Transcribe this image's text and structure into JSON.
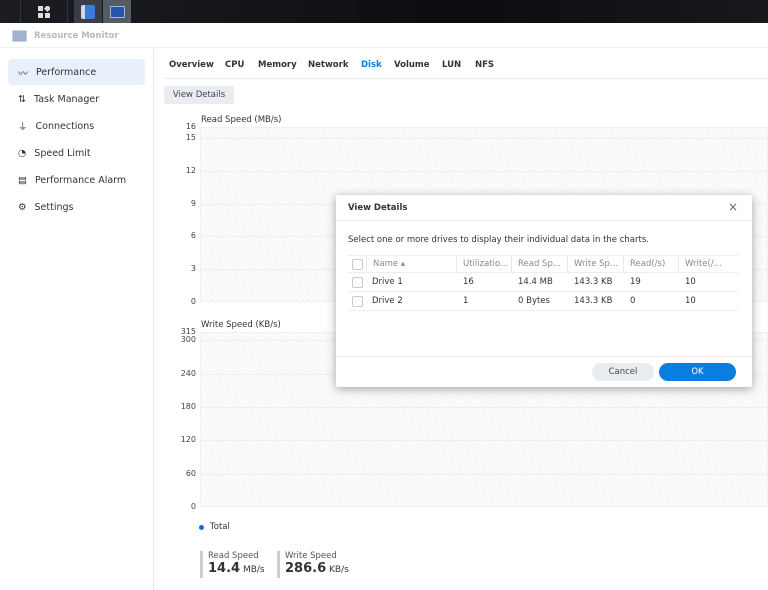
{
  "app": {
    "title": "Resource Monitor"
  },
  "sidebar": {
    "items": [
      {
        "label": "Performance",
        "icon": "performance-icon",
        "active": true
      },
      {
        "label": "Task Manager",
        "icon": "task-manager-icon"
      },
      {
        "label": "Connections",
        "icon": "plug-icon"
      },
      {
        "label": "Speed Limit",
        "icon": "gauge-icon"
      },
      {
        "label": "Performance Alarm",
        "icon": "alarm-icon"
      },
      {
        "label": "Settings",
        "icon": "gear-icon"
      }
    ]
  },
  "tabs": [
    {
      "label": "Overview"
    },
    {
      "label": "CPU"
    },
    {
      "label": "Memory"
    },
    {
      "label": "Network"
    },
    {
      "label": "Disk",
      "active": true
    },
    {
      "label": "Volume"
    },
    {
      "label": "LUN"
    },
    {
      "label": "NFS"
    }
  ],
  "toolbar": {
    "view_details": "View Details"
  },
  "chart_data": [
    {
      "type": "line",
      "title": "Read Speed (MB/s)",
      "ylim": [
        0,
        16
      ],
      "yticks": [
        "16",
        "15",
        "12",
        "9",
        "6",
        "3",
        "0"
      ],
      "series": [
        {
          "name": "Total",
          "values": []
        }
      ]
    },
    {
      "type": "line",
      "title": "Write Speed (KB/s)",
      "ylim": [
        0,
        315
      ],
      "yticks": [
        "315",
        "300",
        "240",
        "180",
        "120",
        "60",
        "0"
      ],
      "series": [
        {
          "name": "Total",
          "values": []
        }
      ]
    }
  ],
  "legend": {
    "label": "Total",
    "color": "#0a6fe0"
  },
  "stats": {
    "read_label": "Read Speed",
    "read_value": "14.4",
    "read_unit": "MB/s",
    "write_label": "Write Speed",
    "write_value": "286.6",
    "write_unit": "KB/s"
  },
  "dialog": {
    "title": "View Details",
    "description": "Select one or more drives to display their individual data in the charts.",
    "columns": [
      "Name ▴",
      "Utilizatio...",
      "Read Sp...",
      "Write Sp...",
      "Read(/s)",
      "Write(/..."
    ],
    "rows": [
      [
        "Drive 1",
        "16",
        "14.4 MB",
        "143.3 KB",
        "19",
        "10"
      ],
      [
        "Drive 2",
        "1",
        "0 Bytes",
        "143.3 KB",
        "0",
        "10"
      ]
    ],
    "cancel": "Cancel",
    "ok": "OK"
  },
  "colors": {
    "accent": "#0a7de0"
  }
}
